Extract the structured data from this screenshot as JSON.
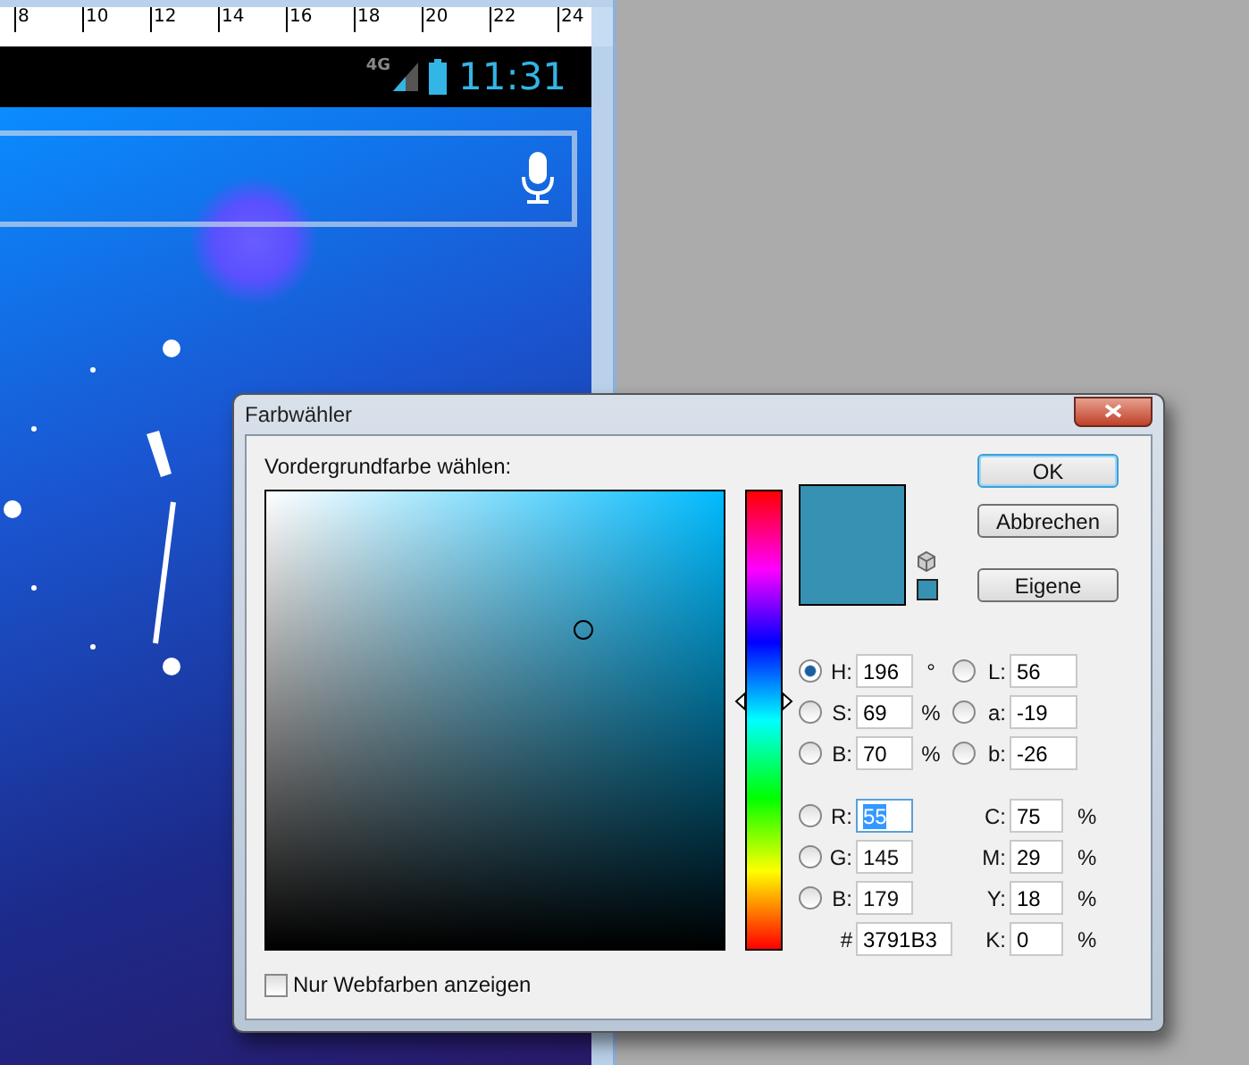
{
  "emulator": {
    "ruler_labels": [
      "8",
      "10",
      "12",
      "14",
      "16",
      "18",
      "20",
      "22",
      "24"
    ],
    "status_bar": {
      "network": "4G",
      "time": "11:31"
    }
  },
  "dialog": {
    "title": "Farbwähler",
    "prompt": "Vordergrundfarbe wählen:",
    "buttons": [
      {
        "label": "OK",
        "default": true
      },
      {
        "label": "Abbrechen",
        "default": false
      },
      {
        "label": "Eigene",
        "default": false
      }
    ],
    "hsb_fields": [
      {
        "label": "H:",
        "value": "196",
        "unit": "°",
        "selected": true
      },
      {
        "label": "S:",
        "value": "69",
        "unit": "%",
        "selected": false
      },
      {
        "label": "B:",
        "value": "70",
        "unit": "%",
        "selected": false
      }
    ],
    "lab_fields": [
      {
        "label": "L:",
        "value": "56",
        "selected": false
      },
      {
        "label": "a:",
        "value": "-19",
        "selected": false
      },
      {
        "label": "b:",
        "value": "-26",
        "selected": false
      }
    ],
    "rgb_fields": [
      {
        "label": "R:",
        "value": "55",
        "selected": false,
        "text_selected": true
      },
      {
        "label": "G:",
        "value": "145",
        "selected": false,
        "text_selected": false
      },
      {
        "label": "B:",
        "value": "179",
        "selected": false,
        "text_selected": false
      }
    ],
    "cmyk_fields": [
      {
        "label": "C:",
        "value": "75",
        "unit": "%"
      },
      {
        "label": "M:",
        "value": "29",
        "unit": "%"
      },
      {
        "label": "Y:",
        "value": "18",
        "unit": "%"
      },
      {
        "label": "K:",
        "value": "0",
        "unit": "%"
      }
    ],
    "hex": {
      "label": "#",
      "value": "3791B3"
    },
    "hue_slider": {
      "level": 0.544
    },
    "web_only": {
      "label": "Nur Webfarben anzeigen",
      "checked": false
    }
  }
}
